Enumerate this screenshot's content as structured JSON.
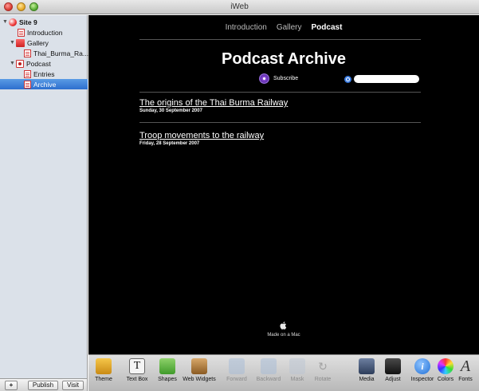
{
  "window": {
    "title": "iWeb"
  },
  "sidebar": {
    "items": [
      {
        "label": "Site 9",
        "kind": "site",
        "disclosure": "▼"
      },
      {
        "label": "Introduction",
        "kind": "page"
      },
      {
        "label": "Gallery",
        "kind": "folder",
        "disclosure": "▼"
      },
      {
        "label": "Thai_Burma_Ra...",
        "kind": "page"
      },
      {
        "label": "Podcast",
        "kind": "podcast",
        "disclosure": "▼"
      },
      {
        "label": "Entries",
        "kind": "page"
      },
      {
        "label": "Archive",
        "kind": "page",
        "selected": true
      }
    ],
    "add_label": "+",
    "publish_label": "Publish",
    "visit_label": "Visit"
  },
  "canvas": {
    "nav": [
      "Introduction",
      "Gallery",
      "Podcast"
    ],
    "nav_active": "Podcast",
    "heading": "Podcast Archive",
    "subscribe_label": "Subscribe",
    "search_placeholder": "",
    "entries": [
      {
        "title": "The origins of the Thai Burma Railway",
        "date": "Sunday, 30 September 2007"
      },
      {
        "title": "Troop movements to the railway",
        "date": "Friday, 28 September 2007"
      }
    ],
    "footer": "Made on a Mac"
  },
  "toolbar": {
    "tools": [
      {
        "label": "Theme",
        "icon": "theme-icon",
        "enabled": true
      },
      {
        "label": "Text Box",
        "icon": "text-box-icon",
        "enabled": true
      },
      {
        "label": "Shapes",
        "icon": "shapes-icon",
        "enabled": true
      },
      {
        "label": "Web Widgets",
        "icon": "web-widgets-icon",
        "enabled": true
      },
      {
        "label": "Forward",
        "icon": "forward-icon",
        "enabled": false
      },
      {
        "label": "Backward",
        "icon": "backward-icon",
        "enabled": false
      },
      {
        "label": "Mask",
        "icon": "mask-icon",
        "enabled": false
      },
      {
        "label": "Rotate",
        "icon": "rotate-icon",
        "enabled": false
      },
      {
        "label": "Media",
        "icon": "media-icon",
        "enabled": true
      },
      {
        "label": "Adjust",
        "icon": "adjust-icon",
        "enabled": true
      },
      {
        "label": "Inspector",
        "icon": "inspector-icon",
        "enabled": true
      },
      {
        "label": "Colors",
        "icon": "colors-icon",
        "enabled": true
      },
      {
        "label": "Fonts",
        "icon": "fonts-icon",
        "enabled": true
      }
    ]
  },
  "colors": {
    "canvas_bg": "#000000",
    "selection": "#3a7bd5",
    "sidebar_bg": "#dbe1e9"
  }
}
